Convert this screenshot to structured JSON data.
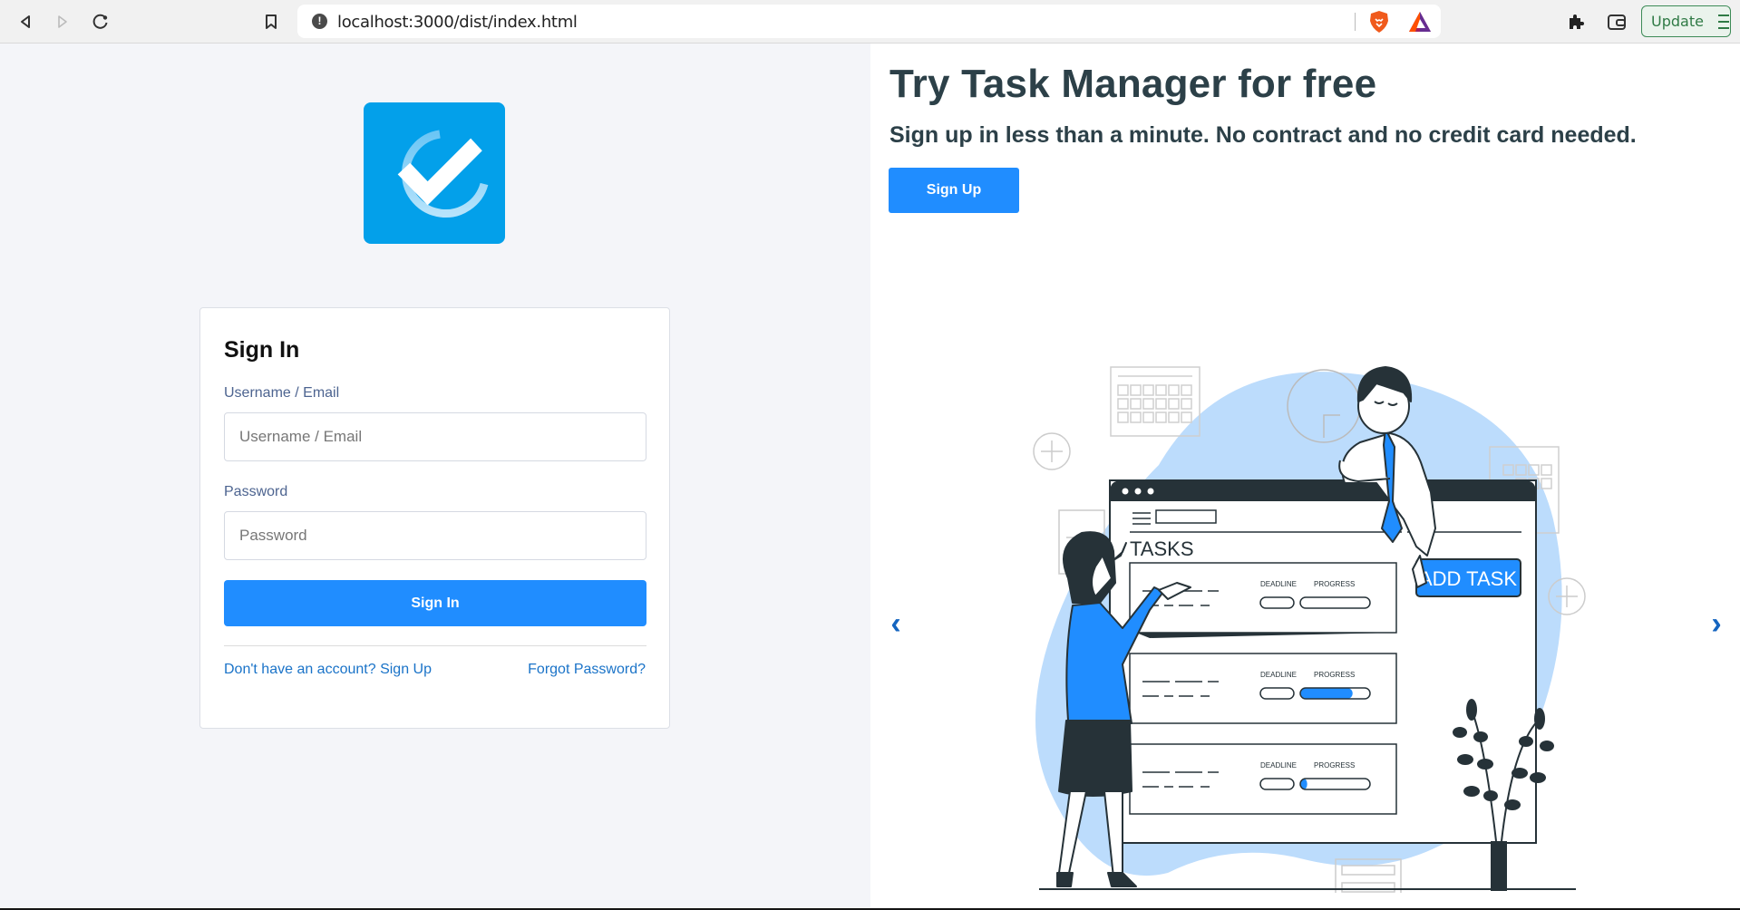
{
  "browser": {
    "url": "localhost:3000/dist/index.html",
    "update_label": "Update",
    "icons": [
      "back-icon",
      "forward-icon",
      "reload-icon",
      "bookmark-icon",
      "site-info-icon",
      "brave-shields-icon",
      "brave-rewards-icon",
      "extensions-icon",
      "wallet-icon",
      "menu-icon"
    ]
  },
  "brand": {
    "logo_icon": "checkmark-circle-icon",
    "colors": {
      "logo_bg": "#03a0ea",
      "primary": "#208dff",
      "heading": "#2c4048",
      "link": "#1a73c8"
    }
  },
  "signin": {
    "title": "Sign In",
    "username_label": "Username / Email",
    "username_placeholder": "Username / Email",
    "username_value": "",
    "password_label": "Password",
    "password_placeholder": "Password",
    "password_value": "",
    "submit_label": "Sign In",
    "signup_link": "Don't have an account? Sign Up",
    "forgot_link": "Forgot Password?"
  },
  "promo": {
    "title": "Try Task Manager for free",
    "subtitle": "Sign up in less than a minute. No contract and no credit card needed.",
    "signup_label": "Sign Up"
  },
  "carousel": {
    "prev_label": "‹",
    "next_label": "›",
    "illustration": {
      "heading": "TASKS",
      "add_button": "ADD TASK",
      "deadline_label": "DEADLINE",
      "progress_label": "PROGRESS",
      "tasks_progress": [
        0,
        0.75,
        0.1
      ]
    }
  }
}
